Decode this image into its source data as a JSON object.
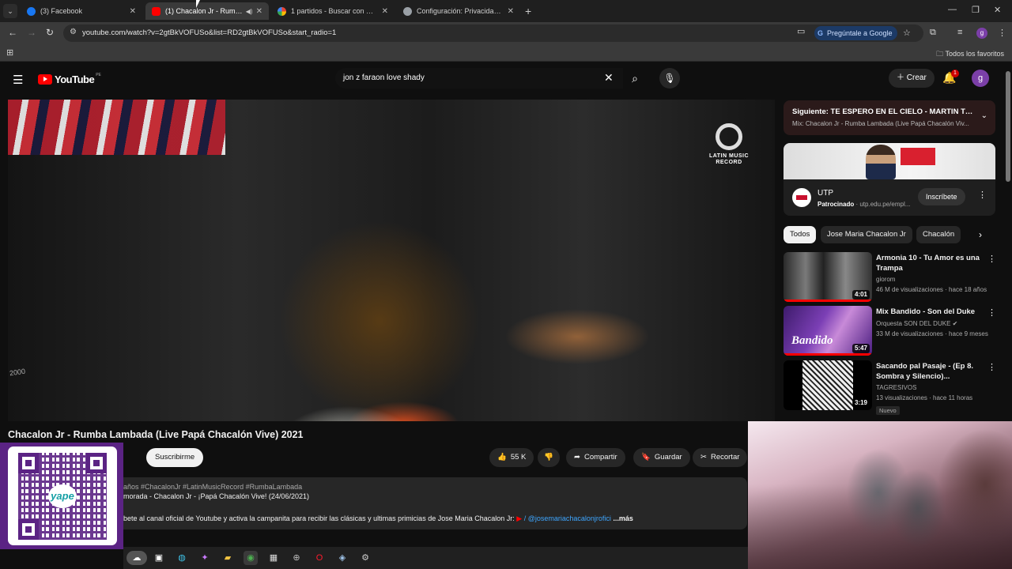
{
  "browser": {
    "tabs": [
      {
        "label": "(3) Facebook",
        "favicon_color": "#1877f2"
      },
      {
        "label": "(1) Chacalon Jr - Rumba Lambada",
        "favicon_color": "#ff0000"
      },
      {
        "label": "1 partidos - Buscar con Google",
        "favicon_color": "#4285f4"
      },
      {
        "label": "Configuración: Privacidad y seguridad",
        "favicon_color": "#9aa0a6"
      }
    ],
    "url": "youtube.com/watch?v=2gtBkVOFUSo&list=RD2gtBkVOFUSo&start_radio=1",
    "ask_google": "Pregúntale a Google",
    "profile_initial": "g",
    "bookmarks_folder": "Todos los favoritos"
  },
  "youtube": {
    "logo_text": "YouTube",
    "country_code": "PE",
    "search_query": "jon z faraon love shady",
    "create_label": "Crear",
    "notifications_count": "1",
    "avatar_initial": "g"
  },
  "player": {
    "channel_logo_text": "LATIN MUSIC RECORD",
    "side_text": "2000"
  },
  "video": {
    "title": "Chacalon Jr - Rumba Lambada (Live Papá Chacalón Vive) 2021",
    "subscribe_label": "Suscribirme",
    "likes": "55 K",
    "share_label": "Compartir",
    "save_label": "Guardar",
    "clip_label": "Recortar",
    "description": {
      "tags_line": "años  #ChacalonJr #LatinMusicRecord #RumbaLambada",
      "subtitle": "morada - Chacalon Jr - ¡Papá Chacalón Vive! (24/06/2021)",
      "body": "bete al canal oficial de Youtube y activa la campanita para recibir las clásicas y ultimas primicias de Jose Maria Chacalon Jr:",
      "handle": "/ @josemariachacalonjrofici",
      "more": "...más"
    }
  },
  "sidebar": {
    "next": {
      "title": "Siguiente: TE ESPERO EN EL CIELO - MARTIN TOLE...",
      "subtitle": "Mix: Chacalon Jr - Rumba Lambada (Live Papá Chacalón Viv..."
    },
    "ad": {
      "name": "UTP",
      "sponsored": "Patrocinado",
      "domain": "utp.edu.pe/empl...",
      "subscribe_label": "Inscríbete"
    },
    "chips": [
      "Todos",
      "Jose Maria Chacalon Jr",
      "Chacalón"
    ],
    "recommendations": [
      {
        "title": "Armonia 10 - Tu Amor es una Trampa",
        "channel": "giorom",
        "meta": "46 M de visualizaciones · hace 18 años",
        "duration": "4:01",
        "watched_fraction": 1.0,
        "badge": ""
      },
      {
        "title": "Mix Bandido - Son del Duke",
        "channel": "Orquesta SON DEL DUKE ✔",
        "meta": "33 M de visualizaciones · hace 9 meses",
        "duration": "5:47",
        "watched_fraction": 1.0,
        "badge": ""
      },
      {
        "title": "Sacando pal Pasaje - (Ep 8. Sombra y Silencio)...",
        "channel": "TAGRESIVOS",
        "meta": "13 visualizaciones · hace 11 horas",
        "duration": "3:19",
        "watched_fraction": 0,
        "badge": "Nuevo"
      }
    ]
  },
  "overlay": {
    "qr_logo_text": "yape"
  }
}
